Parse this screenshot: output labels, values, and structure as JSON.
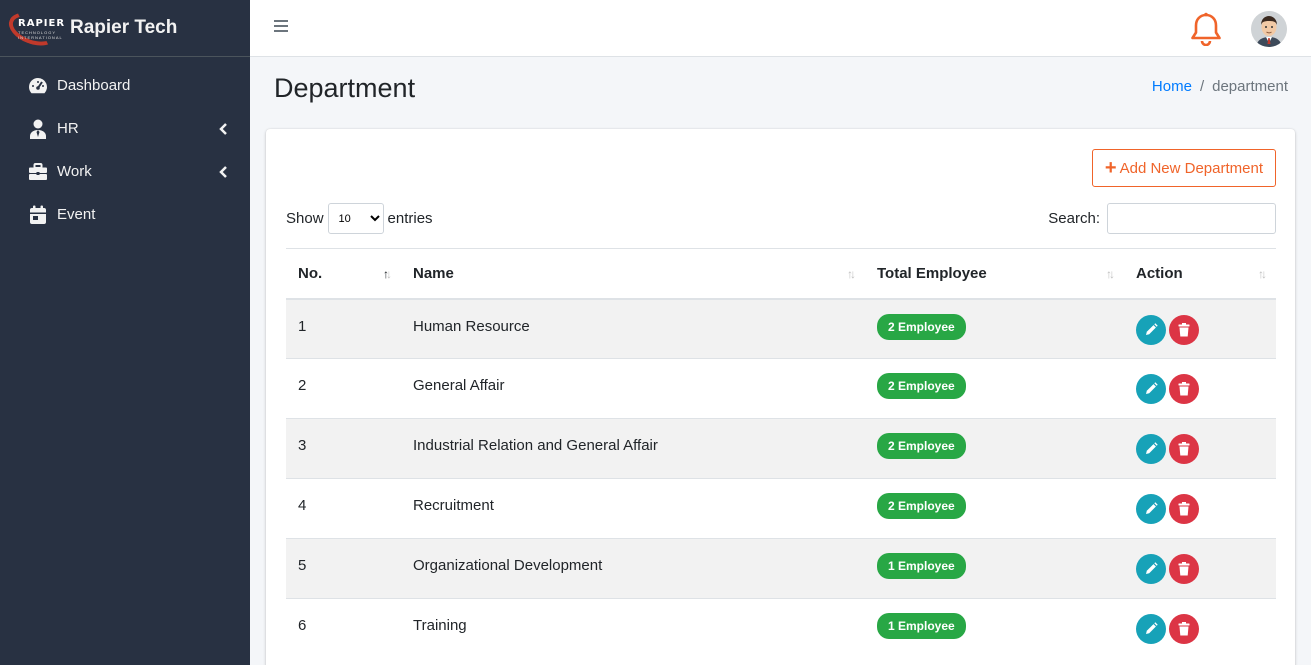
{
  "brand": {
    "logo_word": "RAPIER",
    "logo_sub": "TECHNOLOGY INTERNATIONAL",
    "name": "Rapier Tech"
  },
  "sidebar": {
    "items": [
      {
        "label": "Dashboard",
        "icon": "tachometer-icon"
      },
      {
        "label": "HR",
        "icon": "user-tie-icon",
        "expandable": true
      },
      {
        "label": "Work",
        "icon": "briefcase-icon",
        "expandable": true
      },
      {
        "label": "Event",
        "icon": "calendar-icon"
      }
    ]
  },
  "topbar": {
    "menu_icon": "hamburger-icon",
    "notification_icon": "bell-icon",
    "avatar": "user-avatar"
  },
  "page": {
    "title": "Department",
    "breadcrumb": {
      "home": "Home",
      "separator": "/",
      "current": "department"
    }
  },
  "toolbar": {
    "add_label": "Add New Department",
    "add_icon": "plus-icon"
  },
  "length": {
    "show_label": "Show",
    "value": "10",
    "entries_label": "entries"
  },
  "search": {
    "label": "Search:",
    "value": "",
    "placeholder": ""
  },
  "table": {
    "headers": [
      "No.",
      "Name",
      "Total Employee",
      "Action"
    ],
    "sorted_column": "No.",
    "rows": [
      {
        "no": "1",
        "name": "Human Resource",
        "total": "2 Employee"
      },
      {
        "no": "2",
        "name": "General Affair",
        "total": "2 Employee"
      },
      {
        "no": "3",
        "name": "Industrial Relation and General Affair",
        "total": "2 Employee"
      },
      {
        "no": "4",
        "name": "Recruitment",
        "total": "2 Employee"
      },
      {
        "no": "5",
        "name": "Organizational Development",
        "total": "1 Employee"
      },
      {
        "no": "6",
        "name": "Training",
        "total": "1 Employee"
      }
    ]
  },
  "colors": {
    "sidebar_bg": "#283142",
    "accent_orange": "#f0642a",
    "link_blue": "#007bff",
    "badge_green": "#28a745",
    "edit_teal": "#17a2b8",
    "delete_red": "#dc3545"
  }
}
